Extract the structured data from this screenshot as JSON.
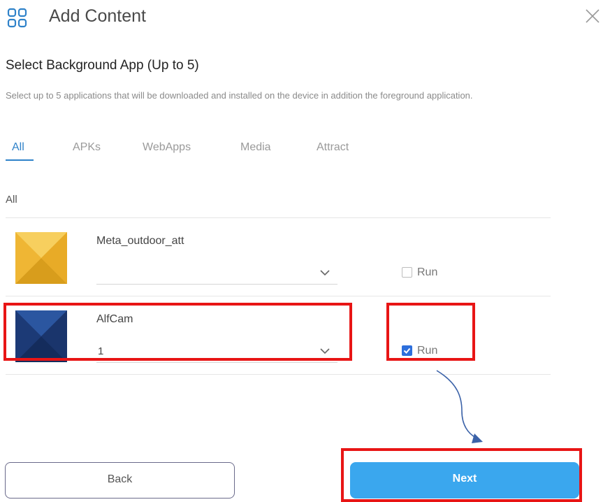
{
  "header": {
    "icon": "grid-icon",
    "title": "Add Content",
    "close_icon": "close-icon"
  },
  "section": {
    "title": "Select Background App (Up to 5)",
    "description": "Select up to 5 applications that will be downloaded and installed on the device in addition the foreground application."
  },
  "tabs": [
    {
      "label": "All",
      "active": true
    },
    {
      "label": "APKs",
      "active": false
    },
    {
      "label": "WebApps",
      "active": false
    },
    {
      "label": "Media",
      "active": false
    },
    {
      "label": "Attract",
      "active": false
    }
  ],
  "group_label": "All",
  "apps": [
    {
      "name": "Meta_outdoor_att",
      "selected_value": "",
      "run_label": "Run",
      "run_checked": false,
      "thumb_color": "#f0b52c"
    },
    {
      "name": "AlfCam",
      "selected_value": "1",
      "run_label": "Run",
      "run_checked": true,
      "thumb_color": "#1e3d7a"
    }
  ],
  "footer": {
    "back_label": "Back",
    "next_label": "Next"
  },
  "colors": {
    "accent": "#2f82c9",
    "next_button": "#3aa7ee",
    "highlight": "#e81515",
    "checkbox_checked": "#2d6fdc"
  }
}
